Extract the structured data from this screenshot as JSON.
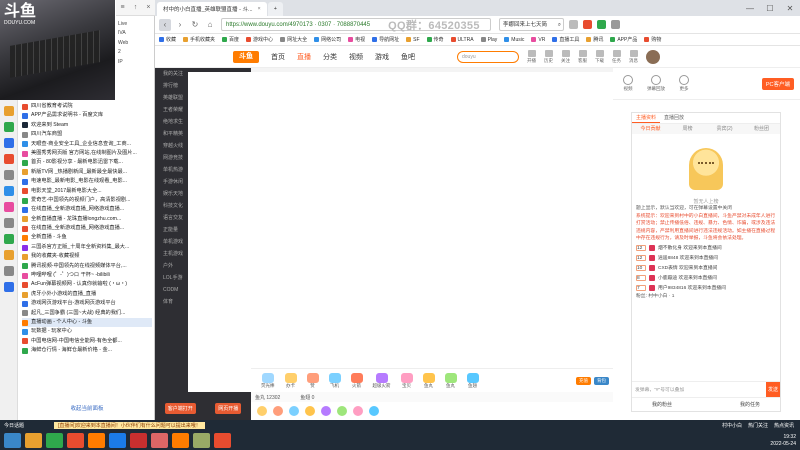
{
  "webcam": {
    "logo": "斗鱼",
    "logo_sub": "DOUYU.COM"
  },
  "sidebar": {
    "header_icons": [
      "≡",
      "↑",
      "×"
    ],
    "pre_items": [
      "Live",
      "IVA",
      "Web",
      "2",
      "IP"
    ],
    "items": [
      {
        "label": "四川省教育考试院",
        "color": "#e84c2f"
      },
      {
        "label": "APP产品需求说明书 - 百度文库",
        "color": "#2f6fe8"
      },
      {
        "label": "欢迎来到 Steam",
        "color": "#1b2838"
      },
      {
        "label": "四川汽车商盟",
        "color": "#888"
      },
      {
        "label": "天眼查-商业安全工具_企业信息查询_工商...",
        "color": "#2f8fe8"
      },
      {
        "label": "美图秀秀网页版 官方网站,在线制图片及图片...",
        "color": "#e84c9f"
      },
      {
        "label": "首页 - 80影视分享 - 最新电影迅雷下载...",
        "color": "#2fa84c"
      },
      {
        "label": "新版TV网 _热播剧新闻_最新最全最快最...",
        "color": "#e8a02f"
      },
      {
        "label": "电速电影_最新电影_电影在线观看_电影...",
        "color": "#2f6fe8"
      },
      {
        "label": "电影天堂_2017最新电影大全...",
        "color": "#e84c2f"
      },
      {
        "label": "爱奇艺-中国领先的视频门户，高清影视剧...",
        "color": "#2fa84c"
      },
      {
        "label": "在线直播_全新游戏直播_网络游戏直播...",
        "color": "#2f6fe8"
      },
      {
        "label": "全新直播直播 - 龙珠直播longzhu.com...",
        "color": "#e8a02f"
      },
      {
        "label": "在线直播_全新游戏直播_网络游戏直播...",
        "color": "#e84c2f"
      },
      {
        "label": "全新直播 - 斗鱼",
        "color": "#ff7c00"
      },
      {
        "label": "三国杀官方正版_十周年全新资料集_最大...",
        "color": "#8a2fe8"
      },
      {
        "label": "我的收藏夹-收藏视频",
        "color": "#e8a02f"
      },
      {
        "label": "腾讯视频-中国领先的在线视频媒体平台,...",
        "color": "#2fa84c"
      },
      {
        "label": "哔哩哔哩 (゜-゜)つロ 干杯~ -bilibili",
        "color": "#e84c9f"
      },
      {
        "label": "AcFun弹幕视频网 - 认真你就输啦 (・ω・)",
        "color": "#e84c2f"
      },
      {
        "label": "虎牙小外小游戏的直播_直播",
        "color": "#e8a02f"
      },
      {
        "label": "游戏网页游戏平台-游戏网页游戏平台",
        "color": "#2f6fe8"
      },
      {
        "label": "起凡_三国争霸 (三国~大战) 经典的我们...",
        "color": "#888"
      },
      {
        "label": "直播动画 - 个人中心 - 斗鱼",
        "color": "#ff7c00"
      },
      {
        "label": "玩数据 - 玩家中心",
        "color": "#2f8fe8"
      },
      {
        "label": "中国电信网-中国电信全能网-有色全都...",
        "color": "#e84c2f"
      },
      {
        "label": "海鲜仓行情 - 海鲜仓最新价格 - 金...",
        "color": "#2fa84c"
      }
    ],
    "selected_index": 23,
    "footer": "收起当前面板"
  },
  "browser": {
    "tabs": [
      {
        "label": "村中的小白直播_英雄联盟直播 - 斗..."
      },
      {
        "label": "+"
      }
    ],
    "window_controls": [
      "—",
      "☐",
      "✕"
    ],
    "url": "https://www.douyu.com/4970173 · 0307 · 7088870445",
    "url_overlay": "QQ群：64520355",
    "search_text": "李娜回来上七天简",
    "bookmarks": [
      "收藏",
      "手机收藏夹",
      "百度",
      "游戏中心",
      "网址大全",
      "网络公司",
      "电视",
      "导航网址",
      "SF",
      "传奇",
      "ULTRA",
      "Play",
      "Music",
      "VR",
      "直播工具",
      "腾讯",
      "APP产品",
      "购物"
    ]
  },
  "douyu": {
    "logo": "斗鱼",
    "nav": [
      "首页",
      "直播",
      "分类",
      "视频",
      "游戏",
      "鱼吧"
    ],
    "active_nav": 1,
    "search_placeholder": "douyu",
    "top_icons": [
      "开播",
      "历史",
      "关注",
      "客服",
      "下载",
      "任务",
      "消息"
    ],
    "left_nav": [
      "我的关注",
      "排行榜",
      "英雄联盟",
      "王者荣耀",
      "绝地求生",
      "和平精英",
      "穿越火线",
      "网游竞技",
      "单机热游",
      "手游休闲",
      "娱乐天地",
      "科技文化",
      "语言交友",
      "正能量",
      "单机游戏",
      "主机游戏",
      "户外",
      "LOL手游",
      "CODM",
      "体育"
    ],
    "left_nav_buttons": [
      "客户端打开",
      "网页开播"
    ]
  },
  "right": {
    "top_buttons": [
      "视频",
      "弹幕回放",
      "更多"
    ],
    "pc_button": "PC客户端",
    "panel_tabs": [
      "主播资料",
      "直播回放"
    ],
    "rank_tabs": [
      "今日贡献",
      "周榜",
      "贵宾(2)",
      "粉丝团"
    ],
    "mascot_caption": "暂无人上榜",
    "intro": "题上显示，默认当欢迎，可在弹幕设置中关闭",
    "system_msg": "系统提示：欢迎来到村中的小白直播间，斗鱼严禁对未成年人进行打赏活动；禁止传播低俗、违规、暴力、色情、诈骗，或涉及违法违规内容，严禁利用直播间进行违法违规活动。如主播在直播过程中存在违规行为，请及时举报，斗鱼将会依法处理。",
    "gifts": [
      {
        "lv": "12",
        "text": "烟不散化身 欢迎来到本直播间"
      },
      {
        "lv": "12",
        "text": "逍遥8848 欢迎来到本直播间"
      },
      {
        "lv": "10",
        "text": "CXD表情 欢迎来到本直播间"
      },
      {
        "lv": "8",
        "text": "小鹿蹦迪 欢迎来到本直播间"
      },
      {
        "lv": "7",
        "text": "用户9834816 欢迎来到本直播间"
      }
    ],
    "fans_line": "粉丝: 村中小白 · 1",
    "chat_placeholder": "发弹幕，\"#\"号可以叠加",
    "send_label": "发送",
    "my_fans": "我的粉丝",
    "my_task": "我的任务"
  },
  "giftbar": {
    "items": [
      "荧光棒",
      "办卡",
      "赞",
      "飞机",
      "火箭",
      "超级火箭",
      "宝贝",
      "鱼丸",
      "鱼丸",
      "鱼翅"
    ],
    "item_colors": [
      "#a0d8ff",
      "#ffcf6b",
      "#ff9e7b",
      "#7bd0ff",
      "#ff7c5a",
      "#b67bff",
      "#ff9ec2",
      "#ffc44c",
      "#9ee67b",
      "#58c8ff"
    ],
    "right_labels": [
      "充值",
      "背包"
    ],
    "info_left": "鱼丸 12302",
    "info_right": "鱼翅 0"
  },
  "taskbar": {
    "start": "今日话题",
    "news": "[直播间]欢迎来到本直播间！小伙伴们有什么问题可以提出来哦！",
    "right_items": [
      "村中小白",
      "热门关注",
      "热点资讯"
    ],
    "apps": [
      "#3a87c8",
      "#e8a02f",
      "#2fa84c",
      "#e84c2f",
      "#ff7c00",
      "#1b7be8",
      "#c82f2f",
      "#d66",
      "#ff7c00",
      "#9a6",
      "#e84c2f"
    ],
    "clock_time": "19:32",
    "clock_date": "2022-05-24"
  }
}
